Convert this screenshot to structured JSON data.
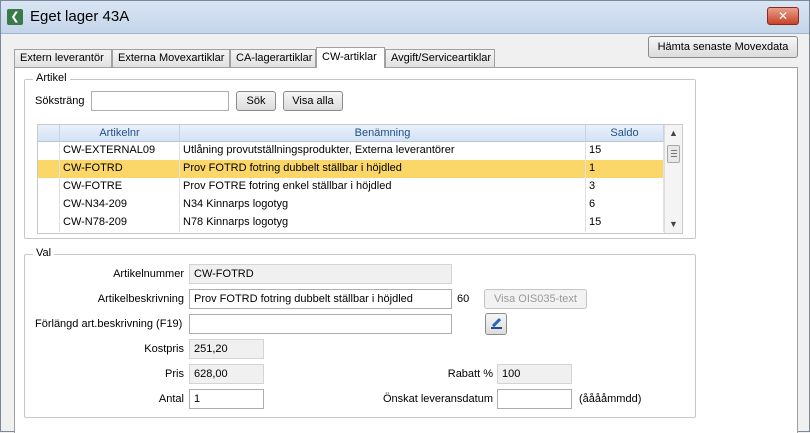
{
  "window": {
    "title": "Eget lager 43A",
    "close_symbol": "✕",
    "app_icon_symbol": "❮"
  },
  "toolbar": {
    "fetch_button": "Hämta senaste Movexdata"
  },
  "tabs": [
    {
      "label": "Extern leverantör",
      "active": false
    },
    {
      "label": "Externa Movexartiklar",
      "active": false
    },
    {
      "label": "CA-lagerartiklar",
      "active": false
    },
    {
      "label": "CW-artiklar",
      "active": true
    },
    {
      "label": "Avgift/Serviceartiklar",
      "active": false
    }
  ],
  "artikel": {
    "legend": "Artikel",
    "search_label": "Söksträng",
    "search_value": "",
    "search_button": "Sök",
    "show_all_button": "Visa alla",
    "columns": [
      "Artikelnr",
      "Benämning",
      "Saldo"
    ],
    "rows": [
      {
        "nr": "CW-EXTERNAL09",
        "name": "Utlåning provutställningsprodukter, Externa leverantörer",
        "saldo": "15",
        "selected": false
      },
      {
        "nr": "CW-FOTRD",
        "name": "Prov FOTRD fotring dubbelt ställbar i höjdled",
        "saldo": "1",
        "selected": true
      },
      {
        "nr": "CW-FOTRE",
        "name": "Prov FOTRE fotring enkel ställbar i höjdled",
        "saldo": "3",
        "selected": false
      },
      {
        "nr": "CW-N34-209",
        "name": "N34 Kinnarps logotyg",
        "saldo": "6",
        "selected": false
      },
      {
        "nr": "CW-N78-209",
        "name": "N78 Kinnarps logotyg",
        "saldo": "15",
        "selected": false
      }
    ],
    "scroll_up": "▲",
    "scroll_down": "▼"
  },
  "val": {
    "legend": "Val",
    "artikelnummer_label": "Artikelnummer",
    "artikelnummer_value": "CW-FOTRD",
    "beskrivning_label": "Artikelbeskrivning",
    "beskrivning_value": "Prov FOTRD fotring dubbelt ställbar i höjdled",
    "beskrivning_maxlen": "60",
    "visa_button": "Visa OIS035-text",
    "forlangd_label": "Förlängd art.beskrivning (F19)",
    "forlangd_value": "",
    "kostpris_label": "Kostpris",
    "kostpris_value": "251,20",
    "pris_label": "Pris",
    "pris_value": "628,00",
    "rabatt_label": "Rabatt %",
    "rabatt_value": "100",
    "antal_label": "Antal",
    "antal_value": "1",
    "leveransdatum_label": "Önskat leveransdatum",
    "leveransdatum_value": "",
    "date_format_hint": "(ååååmmdd)"
  }
}
